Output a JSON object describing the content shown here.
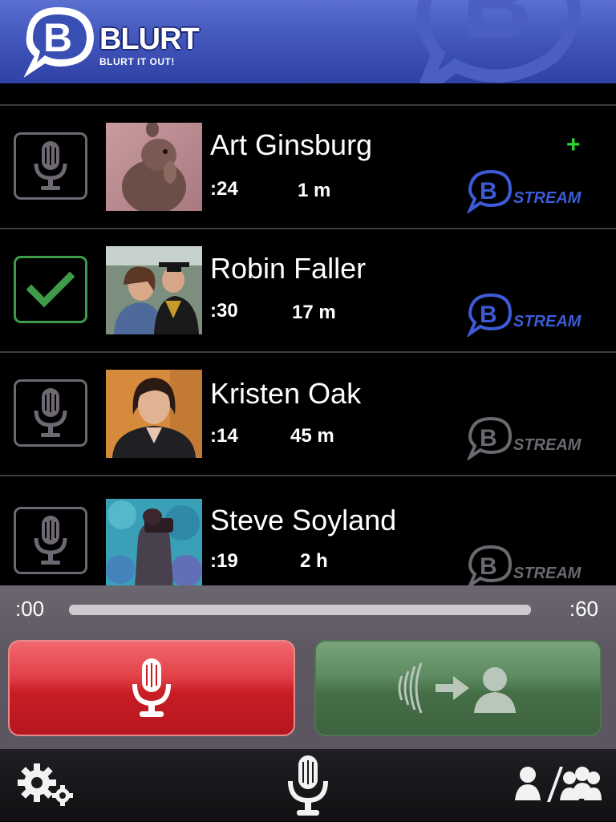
{
  "app": {
    "brand": "BLURT",
    "tagline": "BLURT IT OUT!"
  },
  "colors": {
    "header": "#3e52b8",
    "stream_active": "#3d5bd6",
    "stream_inactive": "#6b6870",
    "checked": "#3f9b4a",
    "plus": "#29d82f",
    "record": "#d92b33",
    "send": "#4f7a52"
  },
  "list": {
    "items": [
      {
        "name": "Art Ginsburg",
        "duration": ":24",
        "age": "1 m",
        "checked": false,
        "new": true,
        "new_label": "+",
        "stream_label": "STREAM",
        "stream_active": true,
        "avatar_icon": "squirrel-photo"
      },
      {
        "name": "Robin Faller",
        "duration": ":30",
        "age": "17 m",
        "checked": true,
        "new": false,
        "stream_label": "STREAM",
        "stream_active": true,
        "avatar_icon": "graduation-photo"
      },
      {
        "name": "Kristen Oak",
        "duration": ":14",
        "age": "45 m",
        "checked": false,
        "new": false,
        "stream_label": "STREAM",
        "stream_active": false,
        "avatar_icon": "portrait-photo"
      },
      {
        "name": "Steve Soyland",
        "duration": ":19",
        "age": "2 h",
        "checked": false,
        "new": false,
        "stream_label": "STREAM",
        "stream_active": false,
        "avatar_icon": "photographer-photo"
      }
    ]
  },
  "progress": {
    "start": ":00",
    "end": ":60",
    "fraction": 0
  },
  "buttons": {
    "record_icon": "microphone-icon",
    "send_icon": "send-to-person-icon"
  },
  "tabbar": {
    "settings_icon": "gears-icon",
    "record_icon": "microphone-icon",
    "contacts_icon": "person-groups-icon"
  }
}
